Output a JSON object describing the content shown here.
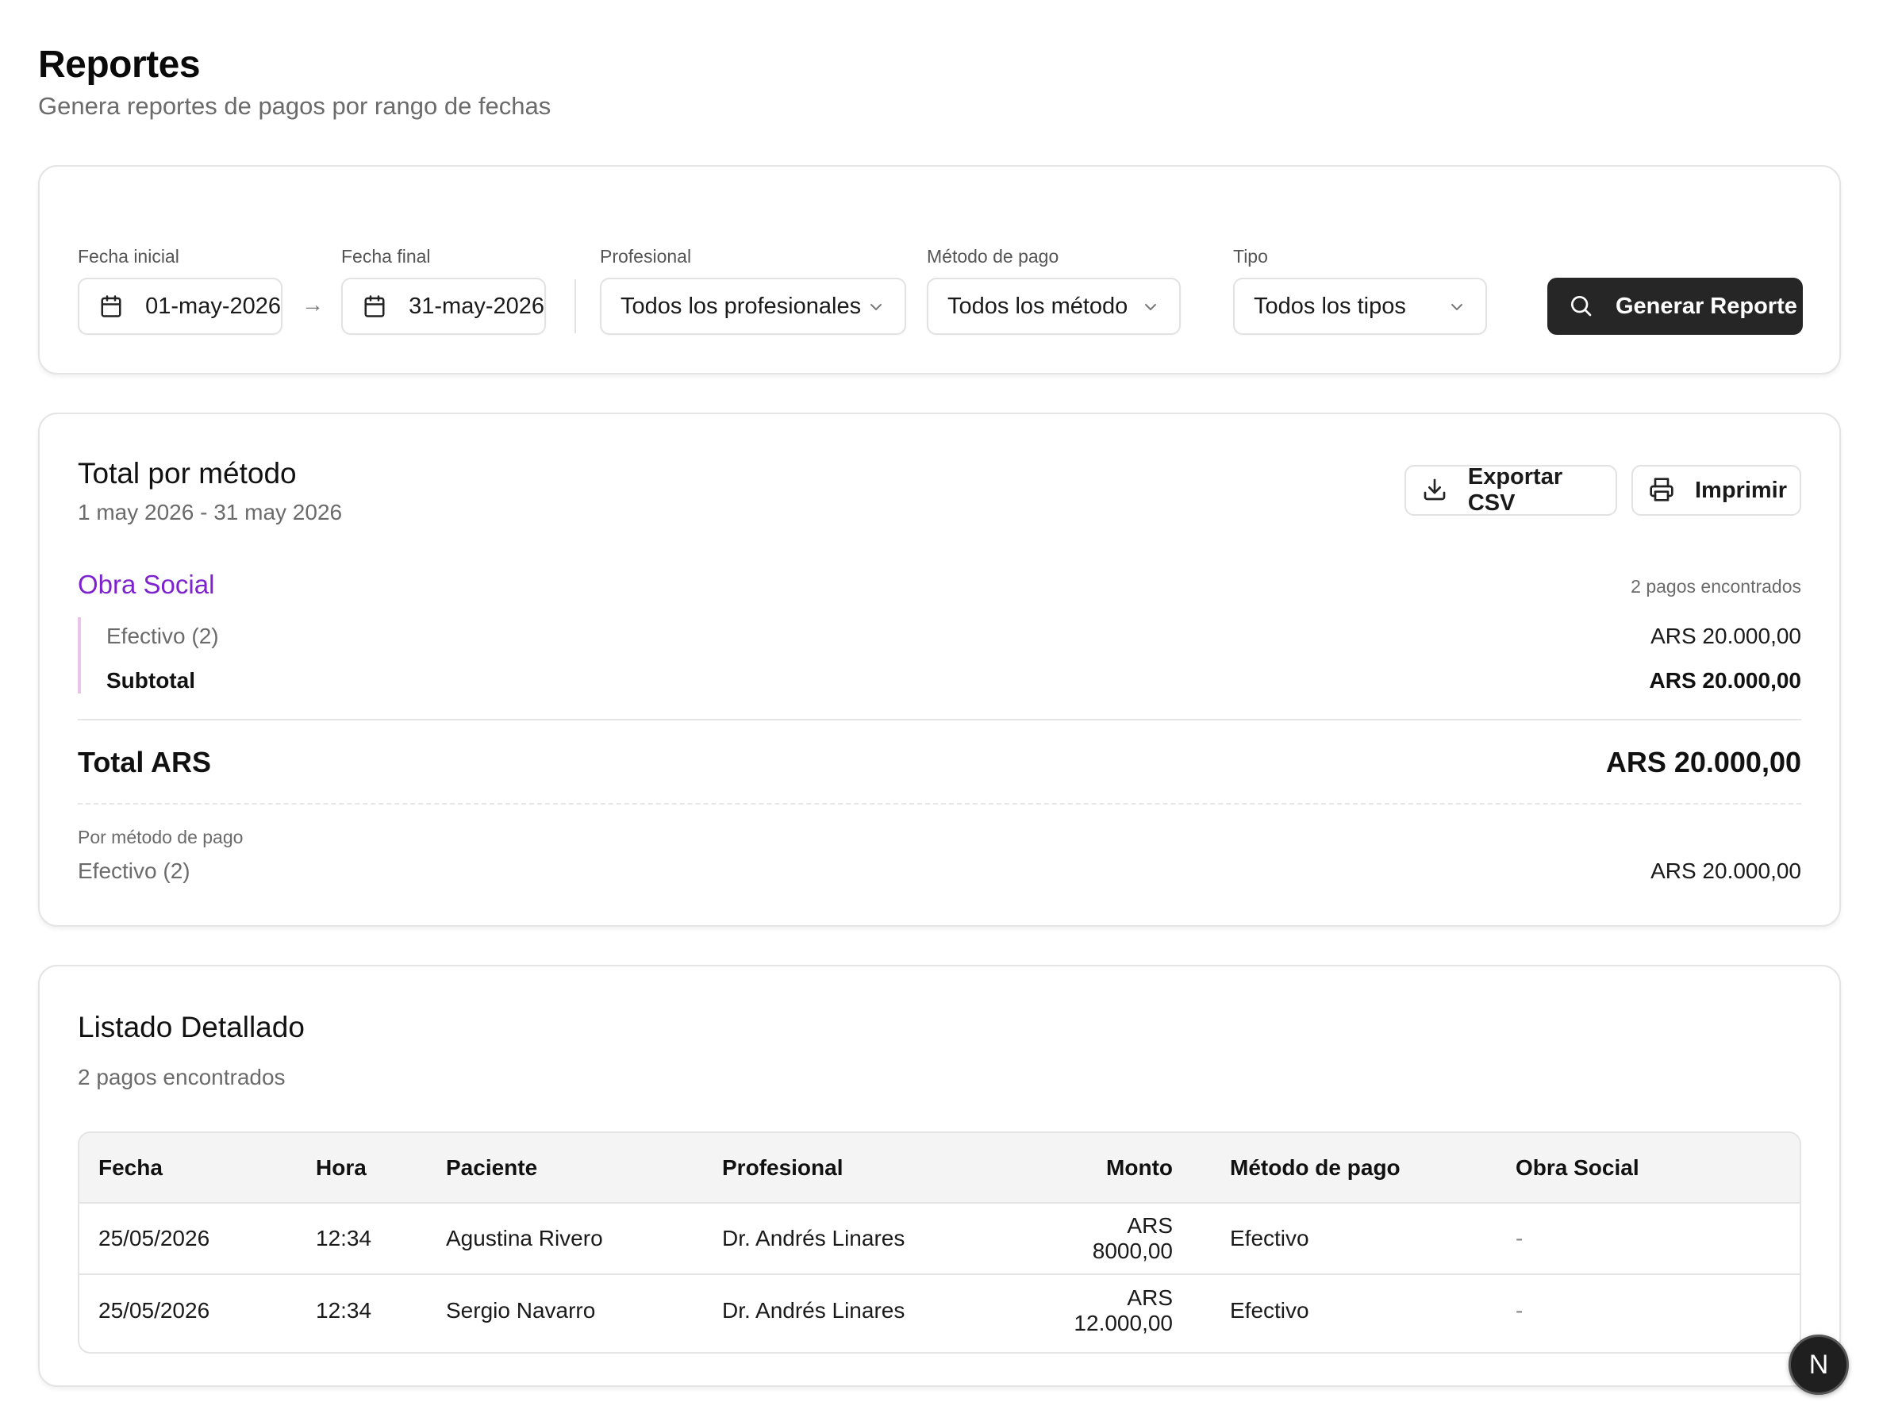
{
  "page": {
    "title": "Reportes",
    "subtitle": "Genera reportes de pagos por rango de fechas"
  },
  "filters": {
    "start_label": "Fecha inicial",
    "start_value": "01-may-2026",
    "end_label": "Fecha final",
    "end_value": "31-may-2026",
    "range_arrow": "→",
    "professional_label": "Profesional",
    "professional_value": "Todos los profesionales",
    "method_label": "Método de pago",
    "method_value": "Todos los método",
    "type_label": "Tipo",
    "type_value": "Todos los tipos",
    "generate_label": "Generar Reporte"
  },
  "totals": {
    "title": "Total por método",
    "range": "1 may 2026 - 31 may 2026",
    "export_label": "Exportar CSV",
    "print_label": "Imprimir",
    "group": {
      "name": "Obra Social",
      "count": "2 pagos encontrados",
      "rows": [
        {
          "label": "Efectivo (2)",
          "amount": "ARS 20.000,00"
        }
      ],
      "subtotal_label": "Subtotal",
      "subtotal_amount": "ARS 20.000,00"
    },
    "total_label": "Total ARS",
    "total_amount": "ARS 20.000,00",
    "by_method_label": "Por método de pago",
    "by_method": [
      {
        "label": "Efectivo (2)",
        "amount": "ARS 20.000,00"
      }
    ]
  },
  "listing": {
    "title": "Listado Detallado",
    "count": "2 pagos encontrados",
    "columns": [
      "Fecha",
      "Hora",
      "Paciente",
      "Profesional",
      "Monto",
      "Método de pago",
      "Obra Social"
    ],
    "rows": [
      [
        "25/05/2026",
        "12:34",
        "Agustina Rivero",
        "Dr. Andrés Linares",
        "ARS 8000,00",
        "Efectivo",
        "-"
      ],
      [
        "25/05/2026",
        "12:34",
        "Sergio Navarro",
        "Dr. Andrés Linares",
        "ARS 12.000,00",
        "Efectivo",
        "-"
      ]
    ]
  },
  "fab": {
    "letter": "N"
  },
  "colors": {
    "accent_purple": "#7e22ce",
    "primary_button": "#262626",
    "group_border": "#e9c3ea"
  }
}
